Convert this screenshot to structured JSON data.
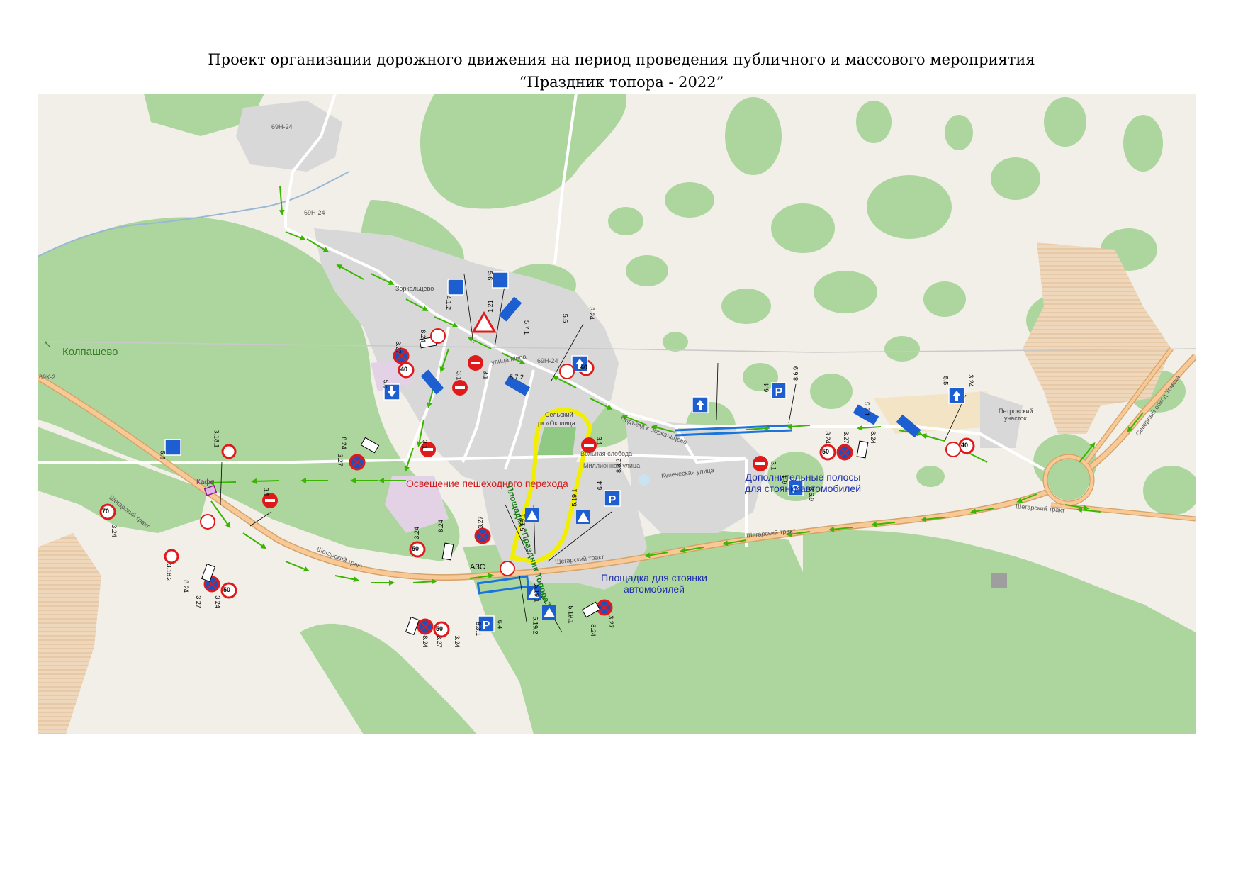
{
  "title": {
    "line1": "Проект организации дорожного движения на период проведения публичного и массового мероприятия",
    "line2": "“Праздник топора - 2022”"
  },
  "map": {
    "colors": {
      "forest": "#a9d59a",
      "land": "#f2efe9",
      "residential": "#d9d9d9",
      "farmland": "#f0d9bf",
      "main_road": "#f8c995",
      "road_casing": "#d4a26a",
      "water": "#9ab8d4",
      "route_arrow": "#3ab500",
      "festival_area": "#f2ee00",
      "parking_outline": "#1a74d9"
    },
    "labels": {
      "direction": "Колпашево",
      "festival_area": "“Площадка “Праздник Топора”",
      "lighting": "Освещение пешеходного перехода",
      "extra_lanes_1": "Дополнительные  полосы",
      "extra_lanes_2": "для стоянкиавтомобилей",
      "parking_1": "Площадка для стоянки",
      "parking_2": "автомобилей",
      "cafe": "Кафе",
      "gas_station": "АЗС",
      "park_1": "Сельский",
      "park_2": "рк «Околица",
      "village": "Зоркальцево",
      "petrov": "Петровский",
      "petrov2": "участок"
    },
    "roads": {
      "r69n24_a": "69Н-24",
      "r69n24_b": "69Н-24",
      "r69n24_c": "69Н-24",
      "shegarsky_1": "Шегарский тракт",
      "shegarsky_2": "Шегарский тракт",
      "shegarsky_3": "Шегарский тракт",
      "shegarsky_4": "Шегарский тракт",
      "shegarsky_5": "Шегарский тракт",
      "ulitsa_mira": "улица Мира",
      "podezd": "Подъезд к Зоркальцево",
      "kupecheskaya": "Купеческая улица",
      "volnaya": "Вольная слобода",
      "miliannaya": "Миллионная улица",
      "severny": "Северный обход Томска",
      "r69k2": "69К-2"
    },
    "sign_codes": {
      "s1": "4.1.2",
      "s2": "5.6",
      "s3": "1.21",
      "s4": "5.7.1",
      "s5": "5.5",
      "s6": "3.24",
      "s7": "8.24",
      "s8": "3.27",
      "s9": "3.1",
      "s10": "3.1",
      "s11": "5.7.2",
      "s12": "5.5",
      "s13": "8.6.9",
      "s14": "6.4",
      "s15": "5.7.1",
      "s16": "5.5",
      "s17": "3.24",
      "s18": "3.18.1",
      "s19": "5.6",
      "s20": "8.24",
      "s21": "3.27",
      "s22": "3.1",
      "s23": "3.1",
      "s24": "3.24",
      "s25": "3.18.2",
      "s26": "8.24",
      "s27": "3.27",
      "s28": "3.24",
      "s29": "3.24",
      "s30": "8.24",
      "s31": "3.27",
      "s32": "5.19.1",
      "s33": "5.19.1",
      "s34": "6.4",
      "s35": "8.3.2",
      "s36": "3.1",
      "s37": "6.4",
      "s38": "8.6.9",
      "s39": "3.24",
      "s40": "3.27",
      "s41": "8.24",
      "s42": "3.1",
      "s43": "6.4",
      "s44": "8.3.1",
      "s45": "3.24",
      "s46": "3.27",
      "s47": "8.24",
      "s48": "5.19.1",
      "s49": "5.19.2",
      "s50": "3.27",
      "s51": "8.24",
      "s52": "5.19.1"
    },
    "speed": {
      "v40": "40",
      "v50": "50",
      "v70": "70"
    },
    "parking_letter": "P"
  }
}
